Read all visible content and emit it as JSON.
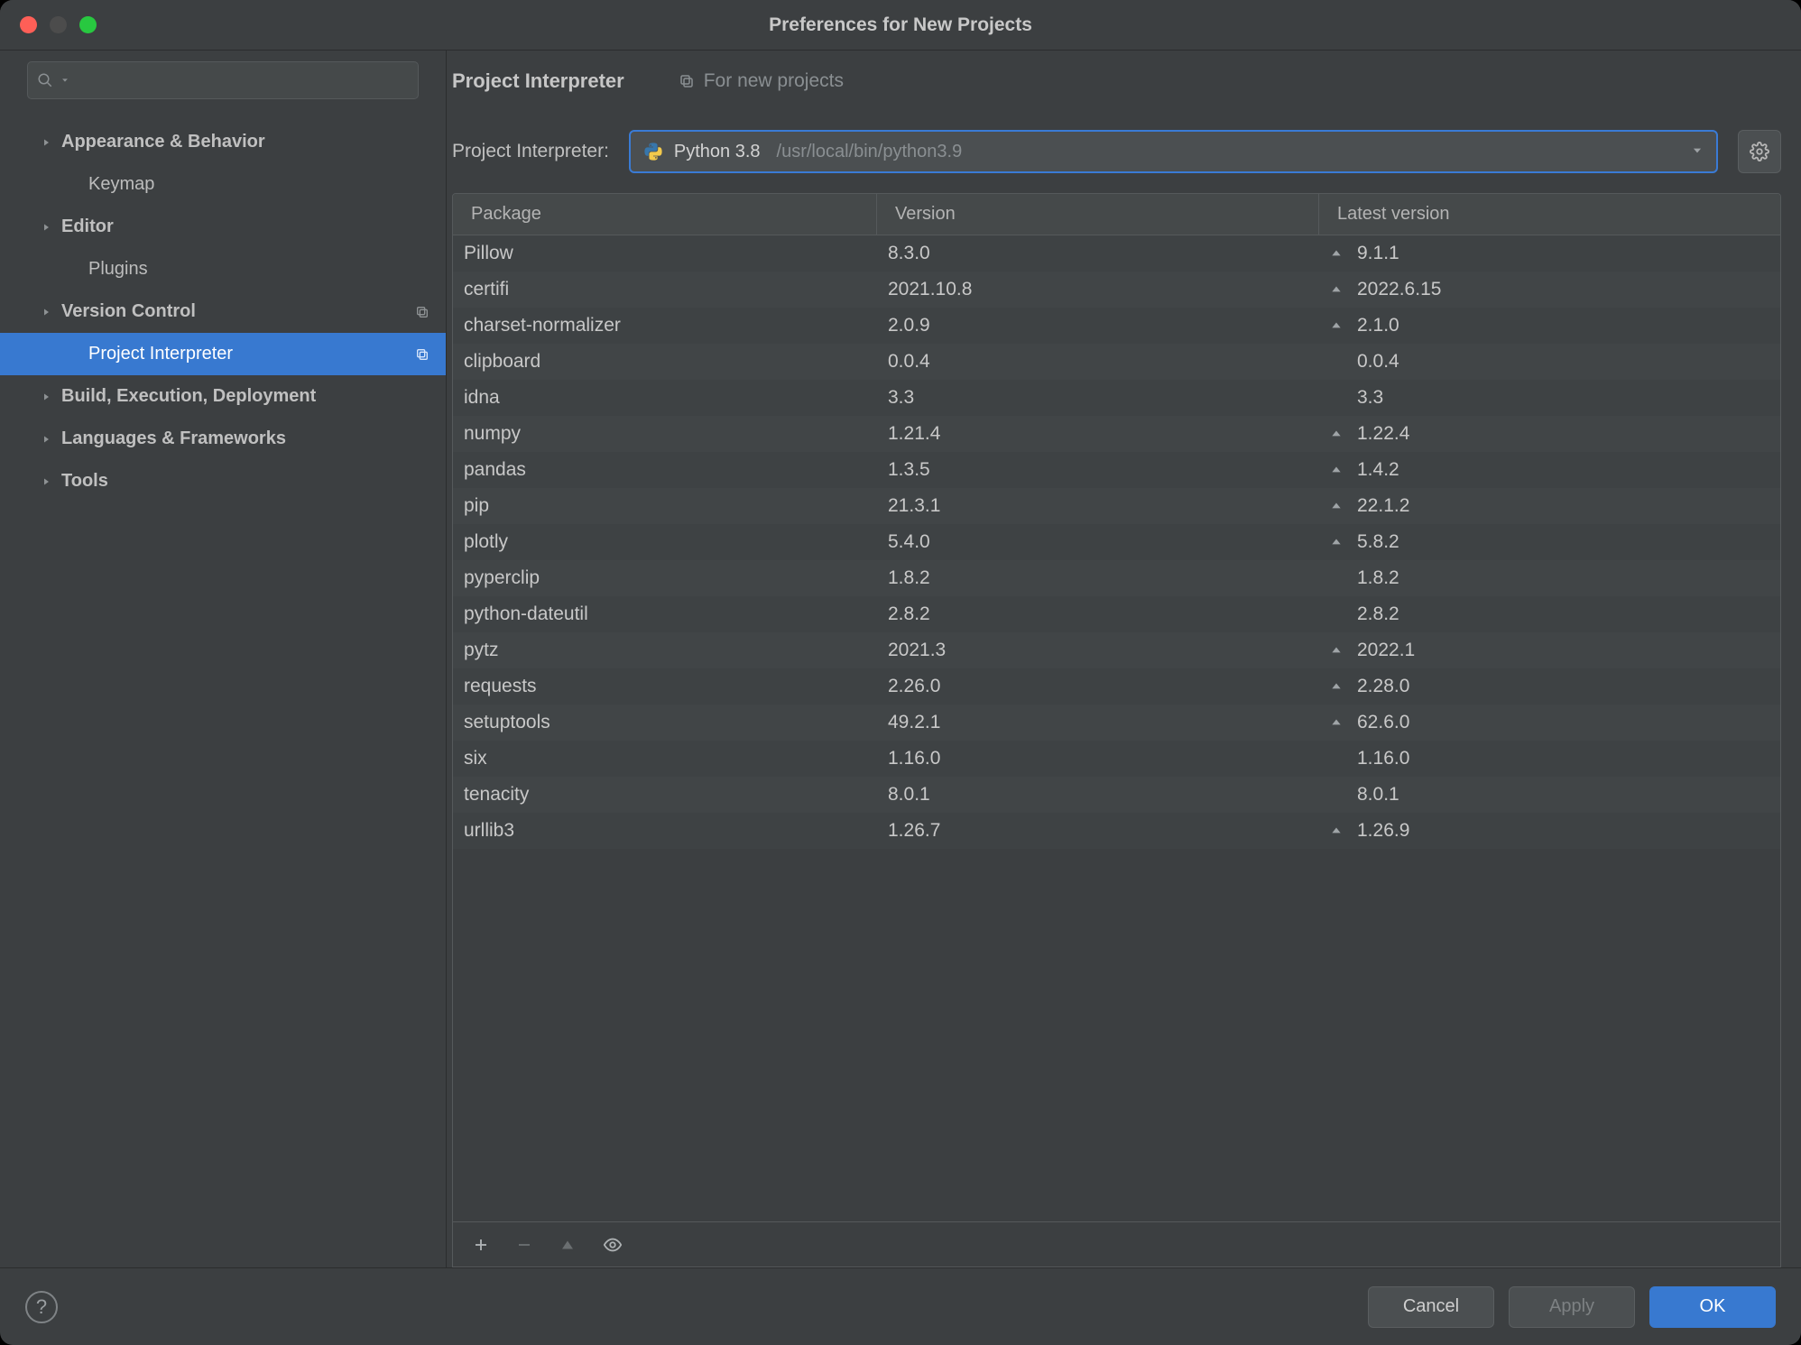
{
  "window": {
    "title": "Preferences for New Projects"
  },
  "sidebar": {
    "search_placeholder": "",
    "items": [
      {
        "label": "Appearance & Behavior",
        "expandable": true,
        "child": false,
        "selected": false,
        "copyable": false
      },
      {
        "label": "Keymap",
        "expandable": false,
        "child": true,
        "selected": false,
        "copyable": false
      },
      {
        "label": "Editor",
        "expandable": true,
        "child": false,
        "selected": false,
        "copyable": false
      },
      {
        "label": "Plugins",
        "expandable": false,
        "child": true,
        "selected": false,
        "copyable": false
      },
      {
        "label": "Version Control",
        "expandable": true,
        "child": false,
        "selected": false,
        "copyable": true
      },
      {
        "label": "Project Interpreter",
        "expandable": false,
        "child": true,
        "selected": true,
        "copyable": true
      },
      {
        "label": "Build, Execution, Deployment",
        "expandable": true,
        "child": false,
        "selected": false,
        "copyable": false
      },
      {
        "label": "Languages & Frameworks",
        "expandable": true,
        "child": false,
        "selected": false,
        "copyable": false
      },
      {
        "label": "Tools",
        "expandable": true,
        "child": false,
        "selected": false,
        "copyable": false
      }
    ]
  },
  "main": {
    "breadcrumb": "Project Interpreter",
    "sub_breadcrumb": "For new projects",
    "interpreter_label": "Project Interpreter:",
    "interpreter_name": "Python 3.8",
    "interpreter_path": "/usr/local/bin/python3.9",
    "table": {
      "headers": {
        "package": "Package",
        "version": "Version",
        "latest": "Latest version"
      },
      "rows": [
        {
          "pkg": "Pillow",
          "ver": "8.3.0",
          "lat": "9.1.1",
          "upd": true
        },
        {
          "pkg": "certifi",
          "ver": "2021.10.8",
          "lat": "2022.6.15",
          "upd": true
        },
        {
          "pkg": "charset-normalizer",
          "ver": "2.0.9",
          "lat": "2.1.0",
          "upd": true
        },
        {
          "pkg": "clipboard",
          "ver": "0.0.4",
          "lat": "0.0.4",
          "upd": false
        },
        {
          "pkg": "idna",
          "ver": "3.3",
          "lat": "3.3",
          "upd": false
        },
        {
          "pkg": "numpy",
          "ver": "1.21.4",
          "lat": "1.22.4",
          "upd": true
        },
        {
          "pkg": "pandas",
          "ver": "1.3.5",
          "lat": "1.4.2",
          "upd": true
        },
        {
          "pkg": "pip",
          "ver": "21.3.1",
          "lat": "22.1.2",
          "upd": true
        },
        {
          "pkg": "plotly",
          "ver": "5.4.0",
          "lat": "5.8.2",
          "upd": true
        },
        {
          "pkg": "pyperclip",
          "ver": "1.8.2",
          "lat": "1.8.2",
          "upd": false
        },
        {
          "pkg": "python-dateutil",
          "ver": "2.8.2",
          "lat": "2.8.2",
          "upd": false
        },
        {
          "pkg": "pytz",
          "ver": "2021.3",
          "lat": "2022.1",
          "upd": true
        },
        {
          "pkg": "requests",
          "ver": "2.26.0",
          "lat": "2.28.0",
          "upd": true
        },
        {
          "pkg": "setuptools",
          "ver": "49.2.1",
          "lat": "62.6.0",
          "upd": true
        },
        {
          "pkg": "six",
          "ver": "1.16.0",
          "lat": "1.16.0",
          "upd": false
        },
        {
          "pkg": "tenacity",
          "ver": "8.0.1",
          "lat": "8.0.1",
          "upd": false
        },
        {
          "pkg": "urllib3",
          "ver": "1.26.7",
          "lat": "1.26.9",
          "upd": true
        }
      ]
    }
  },
  "buttons": {
    "cancel": "Cancel",
    "apply": "Apply",
    "ok": "OK"
  }
}
